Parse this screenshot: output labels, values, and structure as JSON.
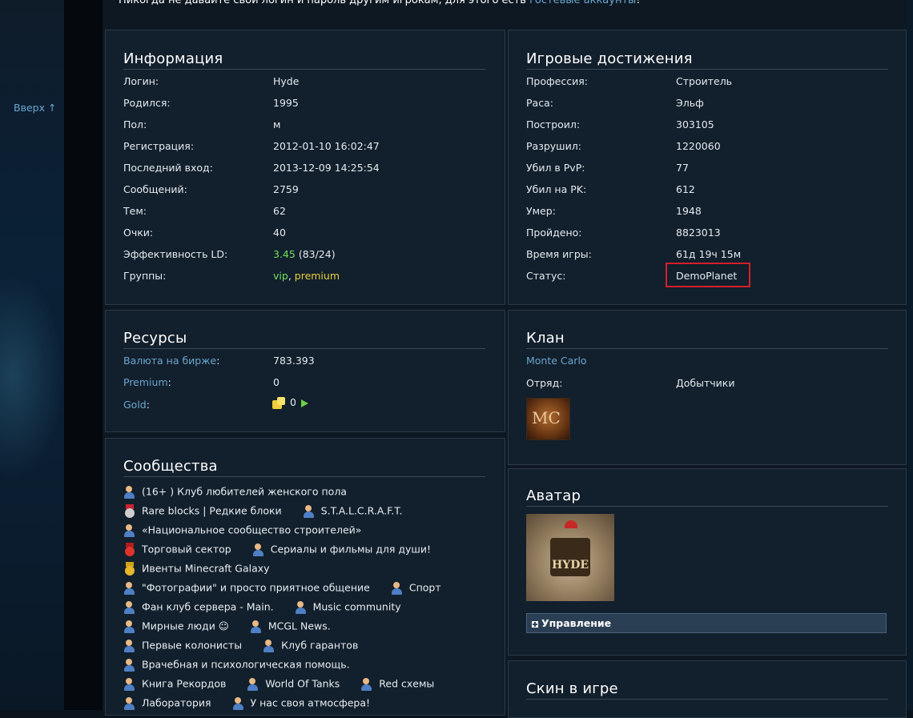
{
  "nav": {
    "up_label": "Вверх ↑"
  },
  "notice": {
    "text": "Никогда не давайте свой логин и пароль другим игрокам, для этого есть ",
    "link": "гостевые аккаунты",
    "tail": "!"
  },
  "info": {
    "title": "Информация",
    "rows": [
      {
        "k": "Логин:",
        "v": "Hyde"
      },
      {
        "k": "Родился:",
        "v": "1995"
      },
      {
        "k": "Пол:",
        "v": "м"
      },
      {
        "k": "Регистрация:",
        "v": "2012-01-10 16:02:47"
      },
      {
        "k": "Последний вход:",
        "v": "2013-12-09 14:25:54"
      },
      {
        "k": "Сообщений:",
        "v": "2759"
      },
      {
        "k": "Тем:",
        "v": "62"
      },
      {
        "k": "Очки:",
        "v": "40"
      },
      {
        "k": "Эффективность LD:",
        "v": "3.45",
        "v2": " (83/24)"
      },
      {
        "k": "Группы:",
        "v": "vip",
        "sep": ", ",
        "v2": "premium"
      }
    ]
  },
  "achievements": {
    "title": "Игровые достижения",
    "rows": [
      {
        "k": "Профессия:",
        "v": "Строитель"
      },
      {
        "k": "Раса:",
        "v": "Эльф"
      },
      {
        "k": "Построил:",
        "v": "303105"
      },
      {
        "k": "Разрушил:",
        "v": "1220060"
      },
      {
        "k": "Убил в PvP:",
        "v": "77"
      },
      {
        "k": "Убил на PK:",
        "v": "612"
      },
      {
        "k": "Умер:",
        "v": "1948"
      },
      {
        "k": "Пройдено:",
        "v": "8823013"
      },
      {
        "k": "Время игры:",
        "v": "61д 19ч 15м"
      },
      {
        "k": "Статус:",
        "v": "DemoPlanet"
      }
    ]
  },
  "resources": {
    "title": "Ресурсы",
    "currency_label": "Валюта на бирже",
    "currency_value": "783.393",
    "premium_label": "Premium",
    "premium_value": "0",
    "gold_label": "Gold",
    "gold_value": "0"
  },
  "clan": {
    "title": "Клан",
    "name": "Monte Carlo",
    "squad_label": "Отряд:",
    "squad_value": "Добытчики",
    "logo_text": "MC"
  },
  "avatar": {
    "title": "Аватар",
    "image_text": "HYDE",
    "manage_label": "Управление"
  },
  "skin": {
    "title": "Скин в игре"
  },
  "communities": {
    "title": "Сообщества",
    "items": [
      {
        "icon": "user",
        "label": "(16+ ) Клуб любителей женского пола"
      },
      {
        "icon": "medal",
        "label": "Rare blocks | Редкие блоки"
      },
      {
        "icon": "user",
        "label": "S.T.A.L.C.R.A.F.T."
      },
      {
        "icon": "user",
        "label": "«Национальное сообщество строителей»"
      },
      {
        "icon": "red",
        "label": "Торговый сектор"
      },
      {
        "icon": "user",
        "label": "Сериалы и фильмы для души!"
      },
      {
        "icon": "gold",
        "label": "Ивенты Minecraft Galaxy"
      },
      {
        "icon": "user",
        "label": "\"Фотографии\" и просто приятное общение"
      },
      {
        "icon": "user",
        "label": "Спорт"
      },
      {
        "icon": "user",
        "label": "Фан клуб сервера - Main."
      },
      {
        "icon": "user",
        "label": "Music community"
      },
      {
        "icon": "user",
        "label": "Мирные люди ☺"
      },
      {
        "icon": "user",
        "label": "MCGL News."
      },
      {
        "icon": "user",
        "label": "Первые колонисты"
      },
      {
        "icon": "user",
        "label": "Клуб гарантов"
      },
      {
        "icon": "user",
        "label": "Врачебная и психологическая помощь."
      },
      {
        "icon": "user",
        "label": "Книга Рекордов"
      },
      {
        "icon": "user",
        "label": "World Of Tanks"
      },
      {
        "icon": "user",
        "label": "Red схемы"
      },
      {
        "icon": "user",
        "label": "Лаборатория"
      },
      {
        "icon": "user",
        "label": "У нас своя атмосфера!"
      }
    ]
  }
}
